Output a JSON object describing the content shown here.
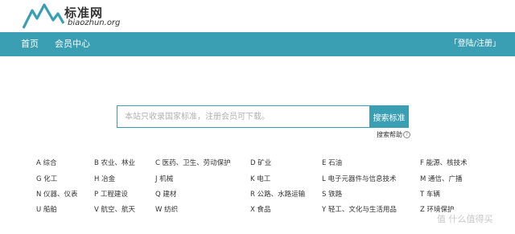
{
  "logo": {
    "name": "标准网",
    "domain": "biaozhun.org"
  },
  "nav": {
    "home": "首页",
    "member": "会员中心",
    "login": "登陆/注册",
    "bracket_open": "「",
    "bracket_close": "」"
  },
  "search": {
    "placeholder": "本站只收录国家标准，注册会员可下载。",
    "button": "搜索标准",
    "help": "搜索帮助",
    "help_icon": "?"
  },
  "categories": [
    [
      "A 综合",
      "B 农业、林业",
      "C 医药、卫生、劳动保护",
      "D 矿业",
      "E 石油",
      "F 能源、核技术"
    ],
    [
      "G 化工",
      "H 冶金",
      "J 机械",
      "K 电工",
      "L 电子元器件与信息技术",
      "M 通信、广播"
    ],
    [
      "N 仪器、仪表",
      "P 工程建设",
      "Q 建材",
      "R 公路、水路运输",
      "S 铁路",
      "T 车辆"
    ],
    [
      "U 船舶",
      "V 航空、航天",
      "W 纺织",
      "X 食品",
      "Y 轻工、文化与生活用品",
      "Z 环境保护"
    ]
  ],
  "watermark": "值 什么值得买",
  "colors": {
    "brand": "#3a9fb3",
    "logo_mountain": "#3a9fb3"
  }
}
